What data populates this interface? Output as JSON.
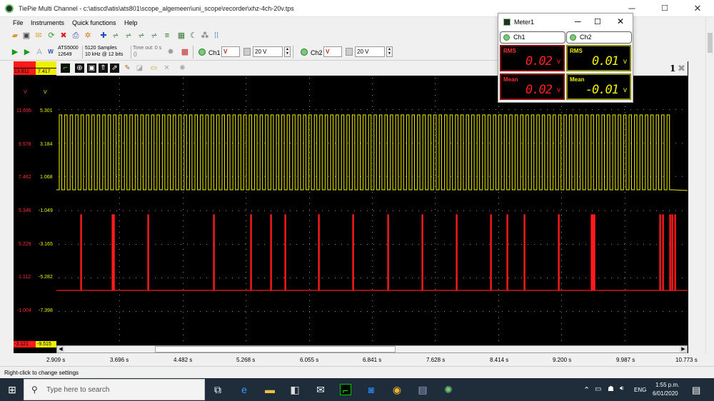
{
  "window": {
    "title": "TiePie Multi Channel - c:\\atiscd\\atis\\ats801\\scope_algemeen\\uni_scope\\recorder\\xhz-4ch-20v.tps",
    "min": "─",
    "max": "☐",
    "close": "✕"
  },
  "menu": [
    "File",
    "Instruments",
    "Quick functions",
    "Help"
  ],
  "instrument": {
    "model": "ATS5000",
    "serial": "12649",
    "samples": "5120 Samples",
    "rate": "10 kHz @ 12 bits",
    "timeout_label": "Time out: 0 s",
    "timeout_val": "()"
  },
  "ch1": {
    "label": "Ch1",
    "range": "20 V",
    "coupling": "V"
  },
  "ch2": {
    "label": "Ch2",
    "range": "20 V",
    "coupling": "V"
  },
  "meter": {
    "title": "Meter1",
    "ch1": "Ch1",
    "ch2": "Ch2",
    "rms_label": "RMS",
    "mean_label": "Mean",
    "ch1_rms": "0.02",
    "ch1_mean": "0.02",
    "ch2_rms": "0.01",
    "ch2_mean": "-0.01",
    "ch1_unit": "v",
    "ch2_unit": "v"
  },
  "scale": {
    "top_red": "13.811",
    "top_yel": "7.417",
    "unit_red": "V",
    "unit_yel": "V",
    "rows": [
      [
        "11.695",
        "5.301"
      ],
      [
        "9.578",
        "3.184"
      ],
      [
        "7.462",
        "1.068"
      ],
      [
        "5.346",
        "-1.049"
      ],
      [
        "5.229",
        "-3.165"
      ],
      [
        "1.112",
        "-5.282"
      ],
      [
        "-1.004",
        "-7.398"
      ]
    ],
    "bot_red": "-3.121",
    "bot_yel": "-9.515"
  },
  "graph_number": "1",
  "time_labels": [
    "2.909 s",
    "3.696 s",
    "4.482 s",
    "5.268 s",
    "6.055 s",
    "6.841 s",
    "7.628 s",
    "8.414 s",
    "9.200 s",
    "9.987 s",
    "10.773 s"
  ],
  "status": "Right-click to change settings",
  "taskbar": {
    "search": "Type here to search",
    "lang": "ENG",
    "time": "1:55 p.m.",
    "date": "6/01/2020"
  },
  "colors": {
    "ch1": "#ff1a1a",
    "ch2": "#f0f000",
    "grid": "#8a8a8a"
  }
}
